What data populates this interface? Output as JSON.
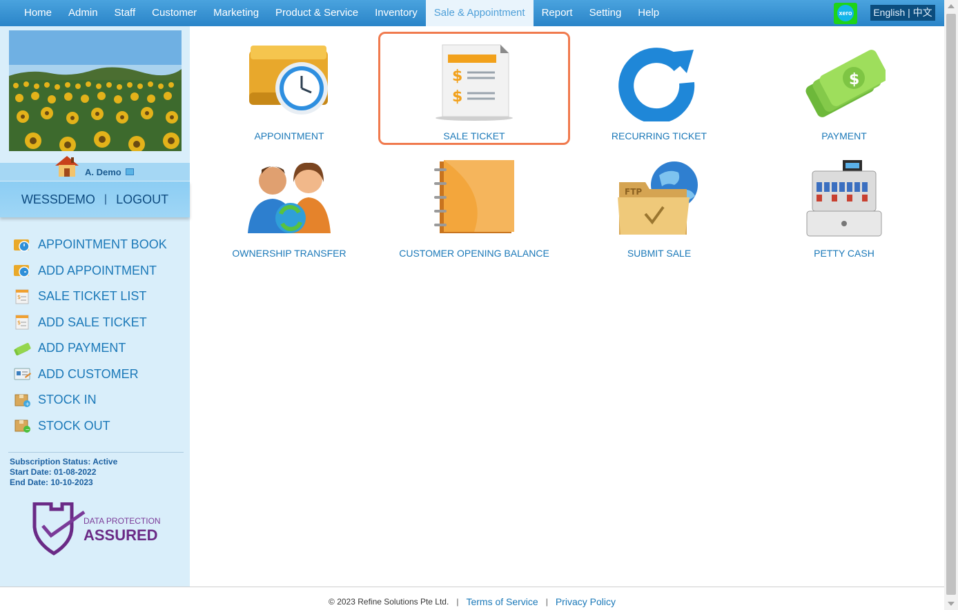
{
  "nav": {
    "items": [
      "Home",
      "Admin",
      "Staff",
      "Customer",
      "Marketing",
      "Product & Service",
      "Inventory",
      "Sale & Appointment",
      "Report",
      "Setting",
      "Help"
    ],
    "active": "Sale & Appointment",
    "xero_label": "xero",
    "lang_en": "English",
    "lang_sep": "|",
    "lang_zh": "中文"
  },
  "user": {
    "name": "A. Demo",
    "account": "WESSDEMO",
    "separator": "|",
    "logout": "LOGOUT"
  },
  "sidebar": {
    "menu": [
      {
        "label": "APPOINTMENT BOOK",
        "icon": "appointment-book-icon"
      },
      {
        "label": "ADD APPOINTMENT",
        "icon": "add-appointment-icon"
      },
      {
        "label": "SALE TICKET LIST",
        "icon": "sale-ticket-list-icon"
      },
      {
        "label": "ADD SALE TICKET",
        "icon": "add-sale-ticket-icon"
      },
      {
        "label": "ADD PAYMENT",
        "icon": "add-payment-icon"
      },
      {
        "label": "ADD CUSTOMER",
        "icon": "add-customer-icon"
      },
      {
        "label": "STOCK IN",
        "icon": "stock-in-icon"
      },
      {
        "label": "STOCK OUT",
        "icon": "stock-out-icon"
      }
    ],
    "subscription_status": "Subscription Status: Active",
    "start_date": "Start Date: 01-08-2022",
    "end_date": "End Date: 10-10-2023",
    "badge_line1": "DATA PROTECTION",
    "badge_line2": "ASSURED"
  },
  "tiles": [
    {
      "label": "APPOINTMENT",
      "icon": "appointment-clock-icon"
    },
    {
      "label": "SALE TICKET",
      "icon": "sale-ticket-icon",
      "selected": true
    },
    {
      "label": "RECURRING TICKET",
      "icon": "recurring-arrow-icon"
    },
    {
      "label": "PAYMENT",
      "icon": "cash-money-icon"
    },
    {
      "label": "OWNERSHIP TRANSFER",
      "icon": "ownership-transfer-icon"
    },
    {
      "label": "CUSTOMER OPENING BALANCE",
      "icon": "ledger-book-icon"
    },
    {
      "label": "SUBMIT SALE",
      "icon": "ftp-folder-icon"
    },
    {
      "label": "PETTY CASH",
      "icon": "cash-register-icon"
    }
  ],
  "footer": {
    "copyright": "© 2023 Refine Solutions Pte Ltd.",
    "sep": "|",
    "terms": "Terms of Service",
    "privacy": "Privacy Policy"
  },
  "colors": {
    "nav_bg": "#2a84c8",
    "sidebar_bg": "#d9eefa",
    "link": "#1a78b8",
    "highlight": "#f07a4e"
  }
}
